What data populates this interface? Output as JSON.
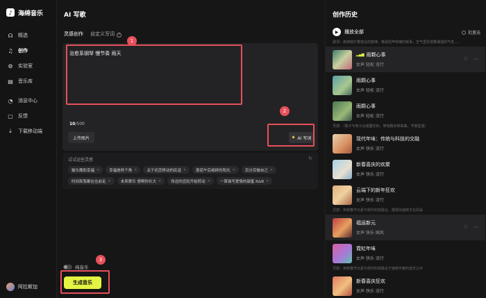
{
  "app": {
    "name": "海绵音乐"
  },
  "sidebar": {
    "items": [
      {
        "label": "精选",
        "icon": "headphones-icon"
      },
      {
        "label": "创作",
        "icon": "music-note-icon",
        "active": true
      },
      {
        "label": "实验室",
        "icon": "lab-icon"
      },
      {
        "label": "音乐库",
        "icon": "library-icon"
      },
      {
        "label": "消息中心",
        "icon": "bell-icon"
      },
      {
        "label": "反馈",
        "icon": "feedback-icon"
      },
      {
        "label": "下载移动端",
        "icon": "download-icon"
      }
    ],
    "user": "阿拉斯加"
  },
  "main": {
    "title": "AI 写歌",
    "tabs": [
      {
        "label": "灵感创作",
        "active": true
      },
      {
        "label": "自定义写词"
      }
    ],
    "help_glyph": "?",
    "editor_text": "治愈系钢琴 慢节奏 雨天",
    "counter_current": "10",
    "counter_max": "/500",
    "upload_label": "上传图片",
    "ai_label": "AI 写词",
    "inspiration": {
      "title": "试试这些灵感",
      "chips_row1": [
        "猫头鹰和幸福",
        "幸福是终个角",
        "关于初恋移动的民谣",
        "唇若午后细碎的阳光",
        "百分百做自己"
      ],
      "chips_row2": [
        "时间和我都在往前走",
        "未来摩乐 想啊你长大",
        "命运的齿轮开始转动",
        "一首描写爱情的甜蜜 R&B"
      ]
    },
    "pure_music_label": "纯音乐",
    "generate_label": "生成音乐",
    "annotations": [
      "1",
      "2",
      "3"
    ]
  },
  "history": {
    "title": "创作历史",
    "play_all": "播放全部",
    "select_all": "批量选",
    "items": [
      {
        "prompt": "歌词：雨滴敲打着窗台的旋律，像是轻声呢喃的故事，空气里弥漫着潮湿的气息……",
        "title": "雨颗心事",
        "tags": "女声 轻松 流行",
        "playing": true
      },
      {
        "title": "雨颗心事",
        "tags": "女声 轻松 流行"
      },
      {
        "title": "雨颗心事",
        "tags": "女声 轻松 流行"
      },
      {
        "prompt": "灵感：（我子与电子合成器交织，穿梭跑步新歌曲，节奏型强）",
        "title": "现代年味：传统与科技的交融",
        "tags": "女声 快乐 流行"
      },
      {
        "title": "新春喜庆的欢聚",
        "tags": "女声 快乐 流行"
      },
      {
        "title": "云端下的新年狂欢",
        "tags": "女声 快乐 流行"
      },
      {
        "prompt": "灵感：传统春节元素与现代科技融合，展现出独特文化风采",
        "title": "福运新元",
        "tags": "女声 快乐 国风"
      },
      {
        "title": "霓虹年味",
        "tags": "女声 快乐 流行"
      },
      {
        "prompt": "灵感：传统春节元素与现代科技融合于独特节奏的音乐之中",
        "title": "新春喜庆狂欢",
        "tags": "女声 快乐 流行"
      }
    ]
  }
}
